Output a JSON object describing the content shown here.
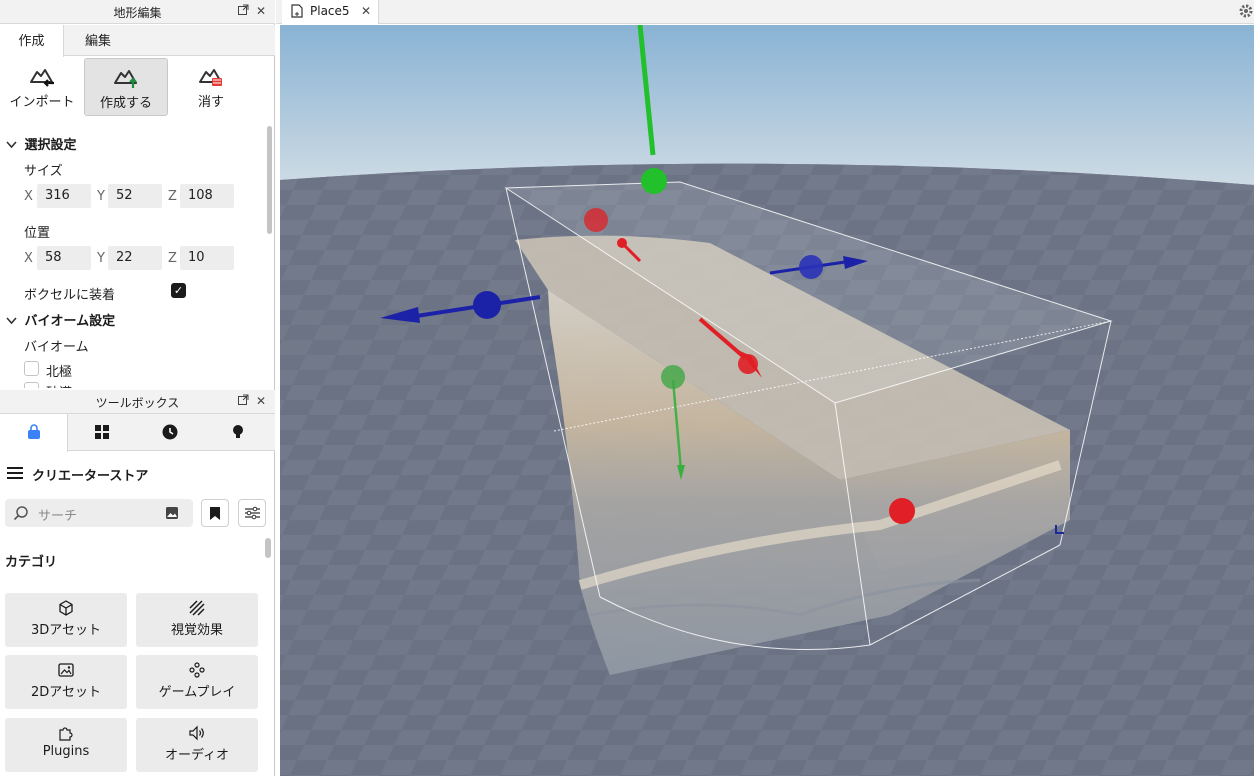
{
  "terrain_panel": {
    "title": "地形編集",
    "tabs": [
      {
        "label": "作成"
      },
      {
        "label": "編集"
      }
    ],
    "tools": [
      {
        "label": "インポート",
        "icon": "terrain-import-icon"
      },
      {
        "label": "作成する",
        "icon": "terrain-generate-icon"
      },
      {
        "label": "消す",
        "icon": "terrain-clear-icon"
      }
    ],
    "selection": {
      "heading": "選択設定",
      "size_label": "サイズ",
      "size": {
        "x": "316",
        "y": "52",
        "z": "108"
      },
      "position_label": "位置",
      "position": {
        "x": "58",
        "y": "22",
        "z": "10"
      },
      "axis_x": "X",
      "axis_y": "Y",
      "axis_z": "Z",
      "snap_label": "ボクセルに装着",
      "snap_checked": true
    },
    "biome": {
      "heading": "バイオーム設定",
      "label": "バイオーム",
      "items": [
        {
          "label": "北極",
          "checked": false
        },
        {
          "label": "砂漠",
          "checked": false
        }
      ]
    }
  },
  "toolbox": {
    "title": "ツールボックス",
    "tabs": [
      "store-bag-icon",
      "grid-icon",
      "clock-icon",
      "lightbulb-icon"
    ],
    "store_title": "クリエーターストア",
    "search_placeholder": "サーチ",
    "category_title": "カテゴリ",
    "categories": [
      {
        "label": "3Dアセット",
        "icon": "cube-icon"
      },
      {
        "label": "視覚効果",
        "icon": "hatch-icon"
      },
      {
        "label": "2Dアセット",
        "icon": "image-icon"
      },
      {
        "label": "ゲームプレイ",
        "icon": "gamepad-icon"
      },
      {
        "label": "Plugins",
        "icon": "puzzle-icon"
      },
      {
        "label": "オーディオ",
        "icon": "speaker-icon"
      }
    ]
  },
  "document": {
    "tab_name": "Place5"
  },
  "colors": {
    "accent": "#3b82f6",
    "gizmo_red": "#e01f26",
    "gizmo_green": "#22c02a",
    "gizmo_blue": "#1c22a8"
  }
}
